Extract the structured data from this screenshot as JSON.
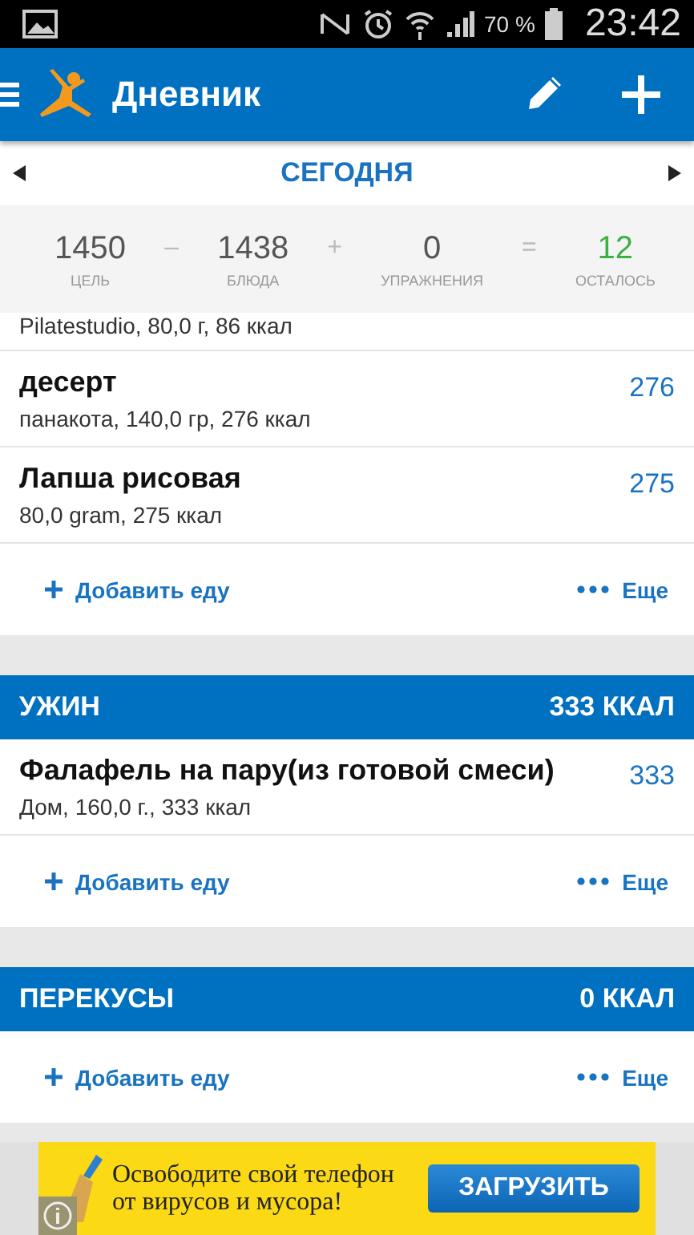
{
  "status_bar": {
    "battery": "70 %",
    "time": "23:42"
  },
  "app_bar": {
    "title": "Дневник"
  },
  "date_nav": {
    "label": "СЕГОДНЯ"
  },
  "summary": [
    {
      "kind": "term",
      "value": "1450",
      "label": "ЦЕЛЬ"
    },
    {
      "kind": "operator",
      "value": "–"
    },
    {
      "kind": "term",
      "value": "1438",
      "label": "БЛЮДА"
    },
    {
      "kind": "operator",
      "value": "+"
    },
    {
      "kind": "term",
      "value": "0",
      "label": "УПРАЖНЕНИЯ"
    },
    {
      "kind": "operator",
      "value": "="
    },
    {
      "kind": "result",
      "value": "12",
      "label": "ОСТАЛОСЬ"
    }
  ],
  "sections": [
    {
      "entries": [
        {
          "kind": "partial",
          "detail": "Pilatestudio, 80,0 г, 86 ккал"
        },
        {
          "kind": "full",
          "name": "десерт",
          "detail": "панакота, 140,0 гр, 276 ккал",
          "calories": "276"
        },
        {
          "kind": "full",
          "name": "Лапша рисовая",
          "detail": "80,0 gram, 275 ккал",
          "calories": "275"
        }
      ],
      "add_label": "Добавить еду",
      "more_label": "Еще"
    },
    {
      "header": {
        "title": "УЖИН",
        "calories": "333 ККАЛ"
      },
      "entries": [
        {
          "kind": "full",
          "name": "Фалафель на пару(из готовой смеси)",
          "detail": "Дом, 160,0 г., 333 ккал",
          "calories": "333"
        }
      ],
      "add_label": "Добавить еду",
      "more_label": "Еще"
    },
    {
      "header": {
        "title": "ПЕРЕКУСЫ",
        "calories": "0 ККАЛ"
      },
      "add_label": "Добавить еду",
      "more_label": "Еще"
    }
  ],
  "ad": {
    "lines": [
      "Освободите свой телефон",
      "от вирусов и мусора!"
    ],
    "button": "ЗАГРУЗИТЬ"
  }
}
